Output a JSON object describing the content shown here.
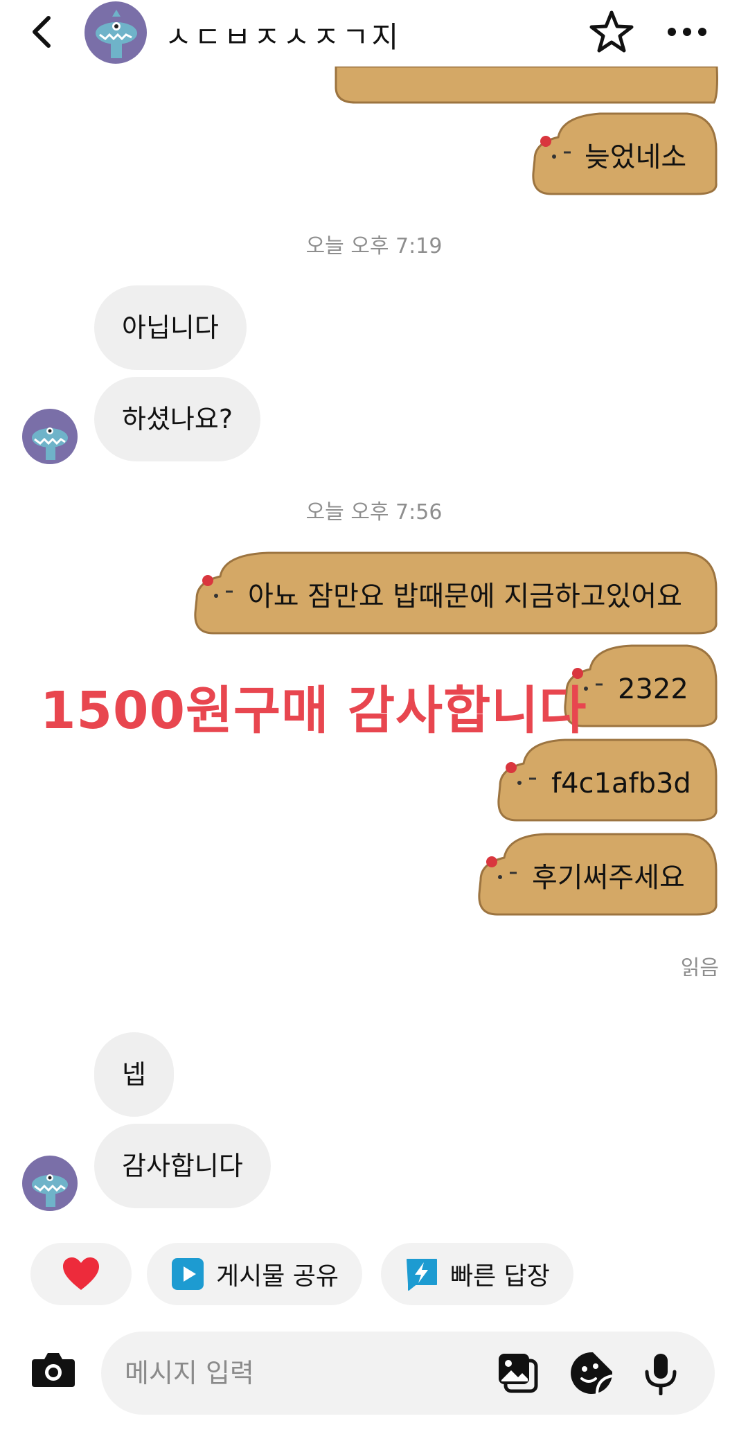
{
  "header": {
    "name": "ㅅㄷㅂㅈㅅㅈㄱ지"
  },
  "stamps": [
    "오늘 오후 7:19",
    "오늘 오후 7:56"
  ],
  "messages": {
    "out_top": "늦었네소",
    "in_1": "아닙니다",
    "in_2": "하셨나요?",
    "out_1": "아뇨 잠만요 밥때문에 지금하고있어요",
    "out_2": "2322",
    "out_3": "f4c1afb3d",
    "out_4": "후기써주세요",
    "in_3": "넵",
    "in_4": "감사합니다"
  },
  "overlay_text": "1500원구매 감사합니다",
  "read_receipt": "읽음",
  "quick_actions": {
    "heart_icon": "heart-icon",
    "share_post": "게시물 공유",
    "quick_reply": "빠른 답장"
  },
  "composer": {
    "placeholder": "메시지 입력"
  },
  "colors": {
    "capybara": "#d4a866",
    "capybara_outline": "#9c7440",
    "overlay_red": "#e8464f",
    "avatar_purple": "#7a6fa8",
    "bubble_gray": "#efefef"
  }
}
